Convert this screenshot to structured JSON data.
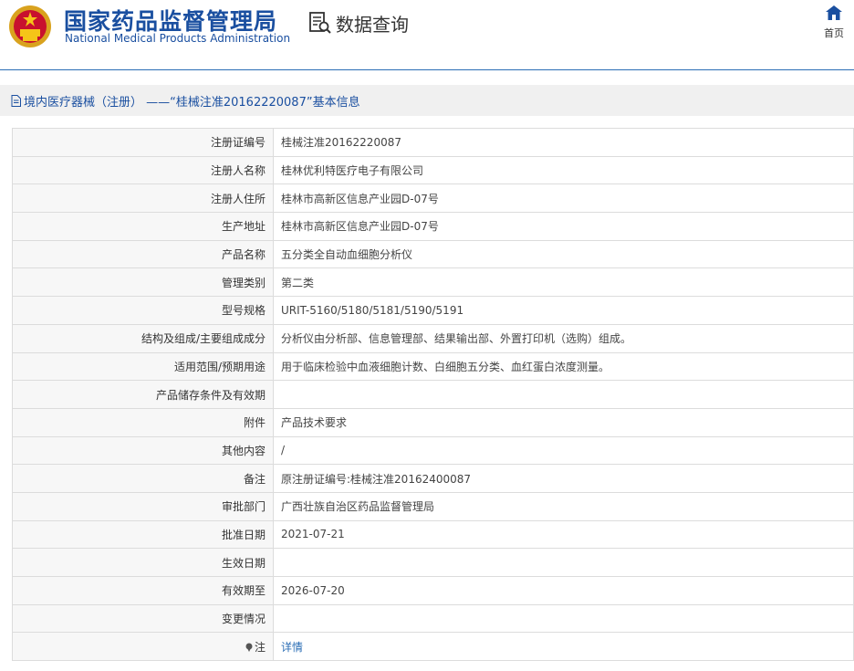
{
  "header": {
    "title_cn": "国家药品监督管理局",
    "title_en": "National Medical Products Administration",
    "data_query": "数据查询",
    "home": "首页"
  },
  "breadcrumb": {
    "text": "境内医疗器械（注册） ——“桂械注准20162220087”基本信息"
  },
  "rows": [
    {
      "label": "注册证编号",
      "value": "桂械注准20162220087"
    },
    {
      "label": "注册人名称",
      "value": "桂林优利特医疗电子有限公司"
    },
    {
      "label": "注册人住所",
      "value": "桂林市高新区信息产业园D-07号"
    },
    {
      "label": "生产地址",
      "value": "桂林市高新区信息产业园D-07号"
    },
    {
      "label": "产品名称",
      "value": "五分类全自动血细胞分析仪"
    },
    {
      "label": "管理类别",
      "value": "第二类"
    },
    {
      "label": "型号规格",
      "value": "URIT-5160/5180/5181/5190/5191"
    },
    {
      "label": "结构及组成/主要组成成分",
      "value": "分析仪由分析部、信息管理部、结果输出部、外置打印机（选购）组成。"
    },
    {
      "label": "适用范围/预期用途",
      "value": "用于临床检验中血液细胞计数、白细胞五分类、血红蛋白浓度测量。"
    },
    {
      "label": "产品储存条件及有效期",
      "value": ""
    },
    {
      "label": "附件",
      "value": "产品技术要求"
    },
    {
      "label": "其他内容",
      "value": "/"
    },
    {
      "label": "备注",
      "value": "原注册证编号:桂械注准20162400087"
    },
    {
      "label": "审批部门",
      "value": "广西壮族自治区药品监督管理局"
    },
    {
      "label": "批准日期",
      "value": "2021-07-21"
    },
    {
      "label": "生效日期",
      "value": ""
    },
    {
      "label": "有效期至",
      "value": "2026-07-20"
    },
    {
      "label": "变更情况",
      "value": ""
    }
  ],
  "note_row": {
    "label": "注",
    "link": "详情"
  },
  "colors": {
    "brand_blue": "#1a4fa0",
    "link_blue": "#2a6db5"
  }
}
